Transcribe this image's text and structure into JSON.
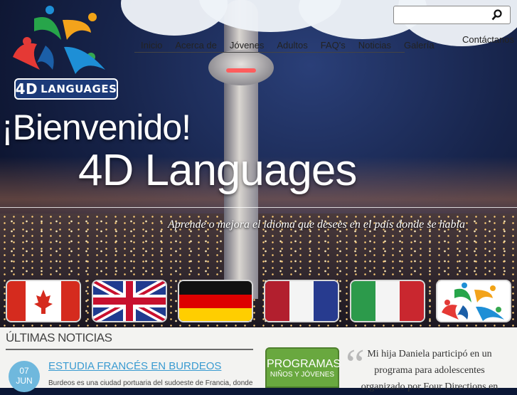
{
  "brand": {
    "logo_text": "LANGUAGES",
    "logo_prefix": "4D"
  },
  "nav": [
    "Inicio",
    "Acerca de",
    "Jóvenes",
    "Adultos",
    "FAQ's",
    "Noticias",
    "Galería"
  ],
  "contact_label": "Contáctanos",
  "search": {
    "placeholder": ""
  },
  "hero": {
    "greeting": "¡Bienvenido!",
    "name": "4D Languages",
    "tagline": "Aprende o mejora el idioma que desees en el país donde se habla"
  },
  "flags": [
    "canada-flag",
    "uk-flag",
    "germany-flag",
    "france-flag",
    "italy-flag",
    "4d-logo"
  ],
  "news": {
    "heading": "ÚLTIMAS NOTICIAS",
    "date_day": "07",
    "date_month": "JUN",
    "article_title": "ESTUDIA FRANCÉS EN BURDEOS",
    "article_excerpt": "Burdeos es una ciudad portuaria del sudoeste de Francia, donde"
  },
  "programs": {
    "title": "PROGRAMAS",
    "subtitle": "NIÑOS Y JÓVENES"
  },
  "testimonial": "Mi hija Daniela participó en un programa para adolescentes organizado por Four Directions en",
  "colors": {
    "link": "#3a9bd1",
    "programs_green": "#69a83f",
    "date_blue": "#6fb8dd"
  }
}
